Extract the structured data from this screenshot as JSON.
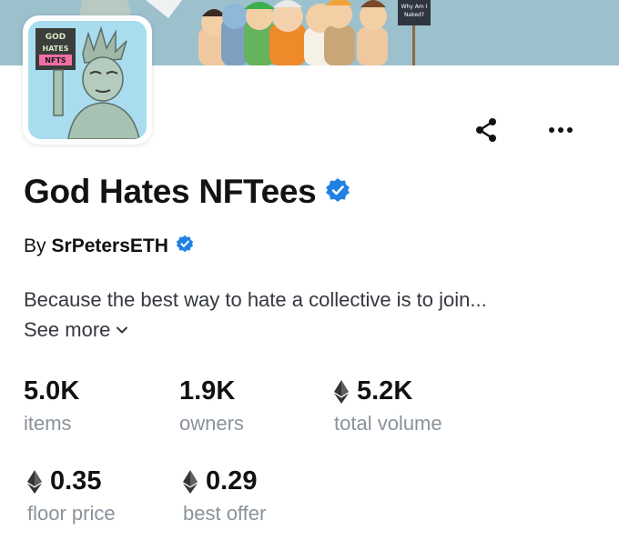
{
  "banner": {
    "sign_text_line1": "Why Am I",
    "sign_text_line2": "Naked?"
  },
  "avatar": {
    "logo_line1": "GOD",
    "logo_line2": "HATES",
    "logo_line3": "NFTS"
  },
  "collection": {
    "title": "God Hates NFTees",
    "by_label": "By",
    "creator": "SrPetersETH",
    "description": "Because the best way to hate a collective is to join...",
    "see_more": "See more"
  },
  "stats": [
    {
      "value": "5.0K",
      "label": "items",
      "eth": false
    },
    {
      "value": "1.9K",
      "label": "owners",
      "eth": false
    },
    {
      "value": "5.2K",
      "label": "total volume",
      "eth": true
    },
    {
      "value": "0.35",
      "label": "floor price",
      "eth": true
    },
    {
      "value": "0.29",
      "label": "best offer",
      "eth": true
    }
  ],
  "colors": {
    "verified": "#2081e2",
    "text_primary": "#121212",
    "text_secondary": "#8a939b"
  },
  "icons": [
    "share-icon",
    "more-icon",
    "verified-badge-icon",
    "chevron-down-icon",
    "ethereum-icon"
  ]
}
